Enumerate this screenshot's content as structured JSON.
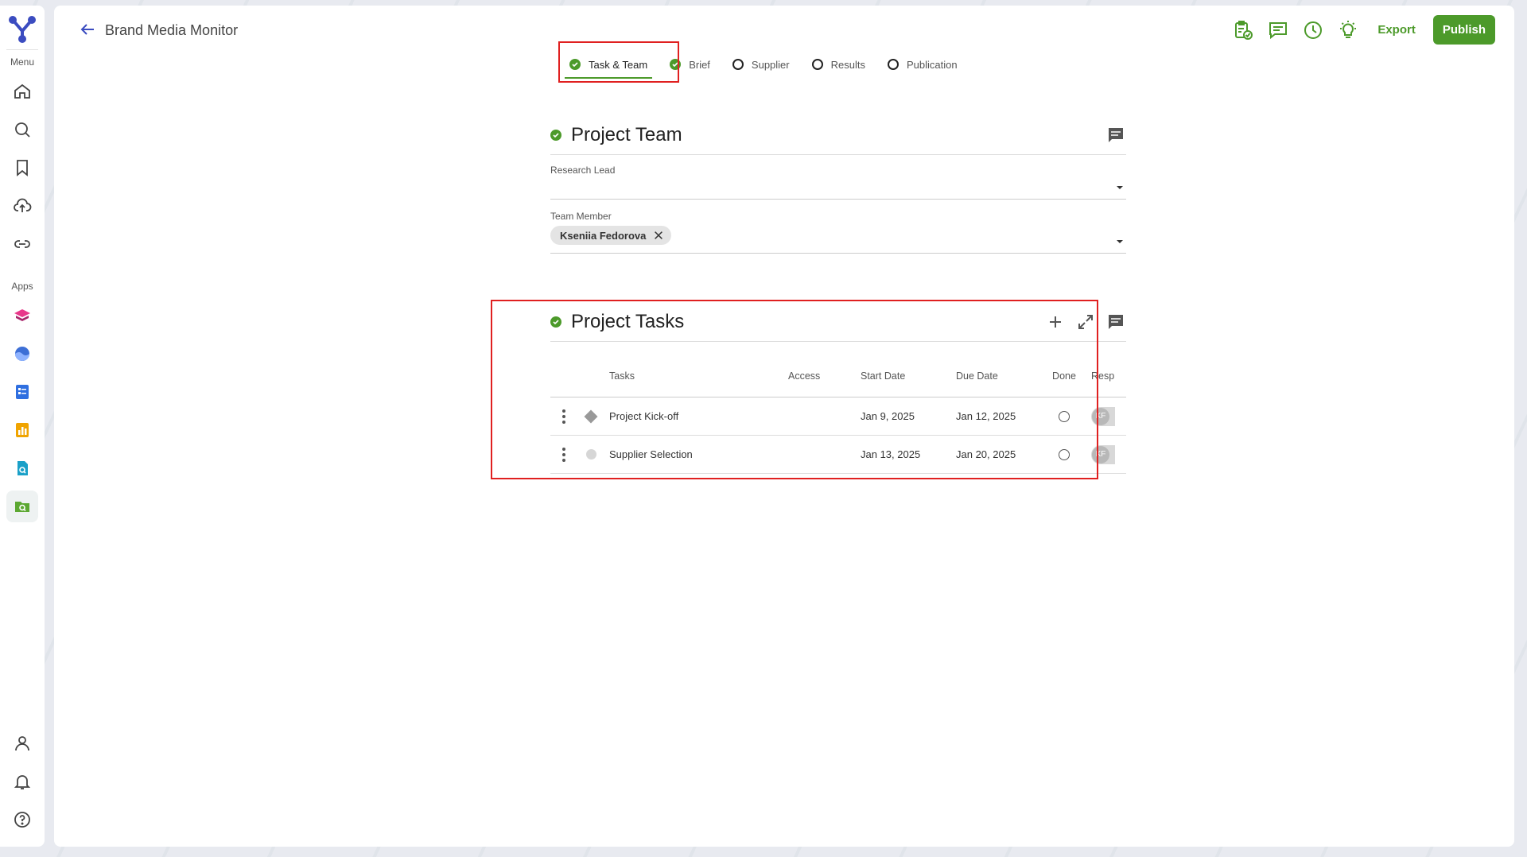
{
  "sidebar": {
    "menu_label": "Menu",
    "apps_label": "Apps",
    "menu_items": [
      "home-icon",
      "search-icon",
      "bookmark-icon",
      "upload-cloud-icon",
      "link-icon"
    ],
    "app_items": [
      "app-stack-icon",
      "app-wave-icon",
      "app-doc-icon",
      "app-chart-icon",
      "app-search-doc-icon",
      "app-folder-search-icon"
    ],
    "bottom_items": [
      "user-icon",
      "bell-icon",
      "help-icon"
    ]
  },
  "header": {
    "title": "Brand Media Monitor",
    "export_label": "Export",
    "publish_label": "Publish",
    "accent_color": "#4c9a2a"
  },
  "tabs": [
    {
      "label": "Task & Team",
      "status": "done",
      "active": true
    },
    {
      "label": "Brief",
      "status": "done",
      "active": false
    },
    {
      "label": "Supplier",
      "status": "open",
      "active": false
    },
    {
      "label": "Results",
      "status": "open",
      "active": false
    },
    {
      "label": "Publication",
      "status": "open",
      "active": false
    }
  ],
  "team": {
    "title": "Project Team",
    "research_lead_label": "Research Lead",
    "research_lead_value": "",
    "team_member_label": "Team Member",
    "members": [
      "Kseniia Fedorova"
    ]
  },
  "tasks": {
    "title": "Project Tasks",
    "columns": [
      "Tasks",
      "Access",
      "Start Date",
      "Due Date",
      "Done",
      "Resp"
    ],
    "rows": [
      {
        "type": "milestone",
        "name": "Project Kick-off",
        "access": "",
        "start": "Jan 9, 2025",
        "due": "Jan 12, 2025",
        "done": false,
        "resp": "KF"
      },
      {
        "type": "task",
        "name": "Supplier Selection",
        "access": "",
        "start": "Jan 13, 2025",
        "due": "Jan 20, 2025",
        "done": false,
        "resp": "KF"
      }
    ]
  }
}
